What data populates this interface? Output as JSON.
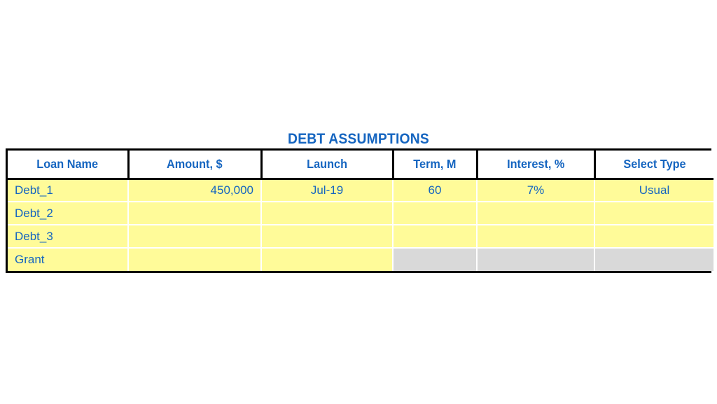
{
  "sheet": {
    "title": "DEBT ASSUMPTIONS",
    "background_color": "#FFFFFF",
    "accent_color": "#1565C0",
    "cell_fill_color": "#FFFB99",
    "disabled_fill_color": "#D9D9D9",
    "border_color": "#000000"
  },
  "table": {
    "headers": [
      {
        "label": "Loan Name",
        "name": "loan-name"
      },
      {
        "label": "Amount, $",
        "name": "amount"
      },
      {
        "label": "Launch",
        "name": "launch"
      },
      {
        "label": "Term, M",
        "name": "term-m"
      },
      {
        "label": "Interest, %",
        "name": "interest-pct"
      },
      {
        "label": "Select Type",
        "name": "select-type"
      }
    ],
    "rows": [
      {
        "loan_name": "Debt_1",
        "amount": "450,000",
        "launch": "Jul-19",
        "term": "60",
        "interest": "7%",
        "select_type": "Usual",
        "disabled_cells": []
      },
      {
        "loan_name": "Debt_2",
        "amount": "",
        "launch": "",
        "term": "",
        "interest": "",
        "select_type": "",
        "disabled_cells": []
      },
      {
        "loan_name": "Debt_3",
        "amount": "",
        "launch": "",
        "term": "",
        "interest": "",
        "select_type": "",
        "disabled_cells": []
      },
      {
        "loan_name": "Grant",
        "amount": "",
        "launch": "",
        "term": "",
        "interest": "",
        "select_type": "",
        "disabled_cells": [
          "term",
          "interest",
          "select_type"
        ]
      }
    ]
  }
}
